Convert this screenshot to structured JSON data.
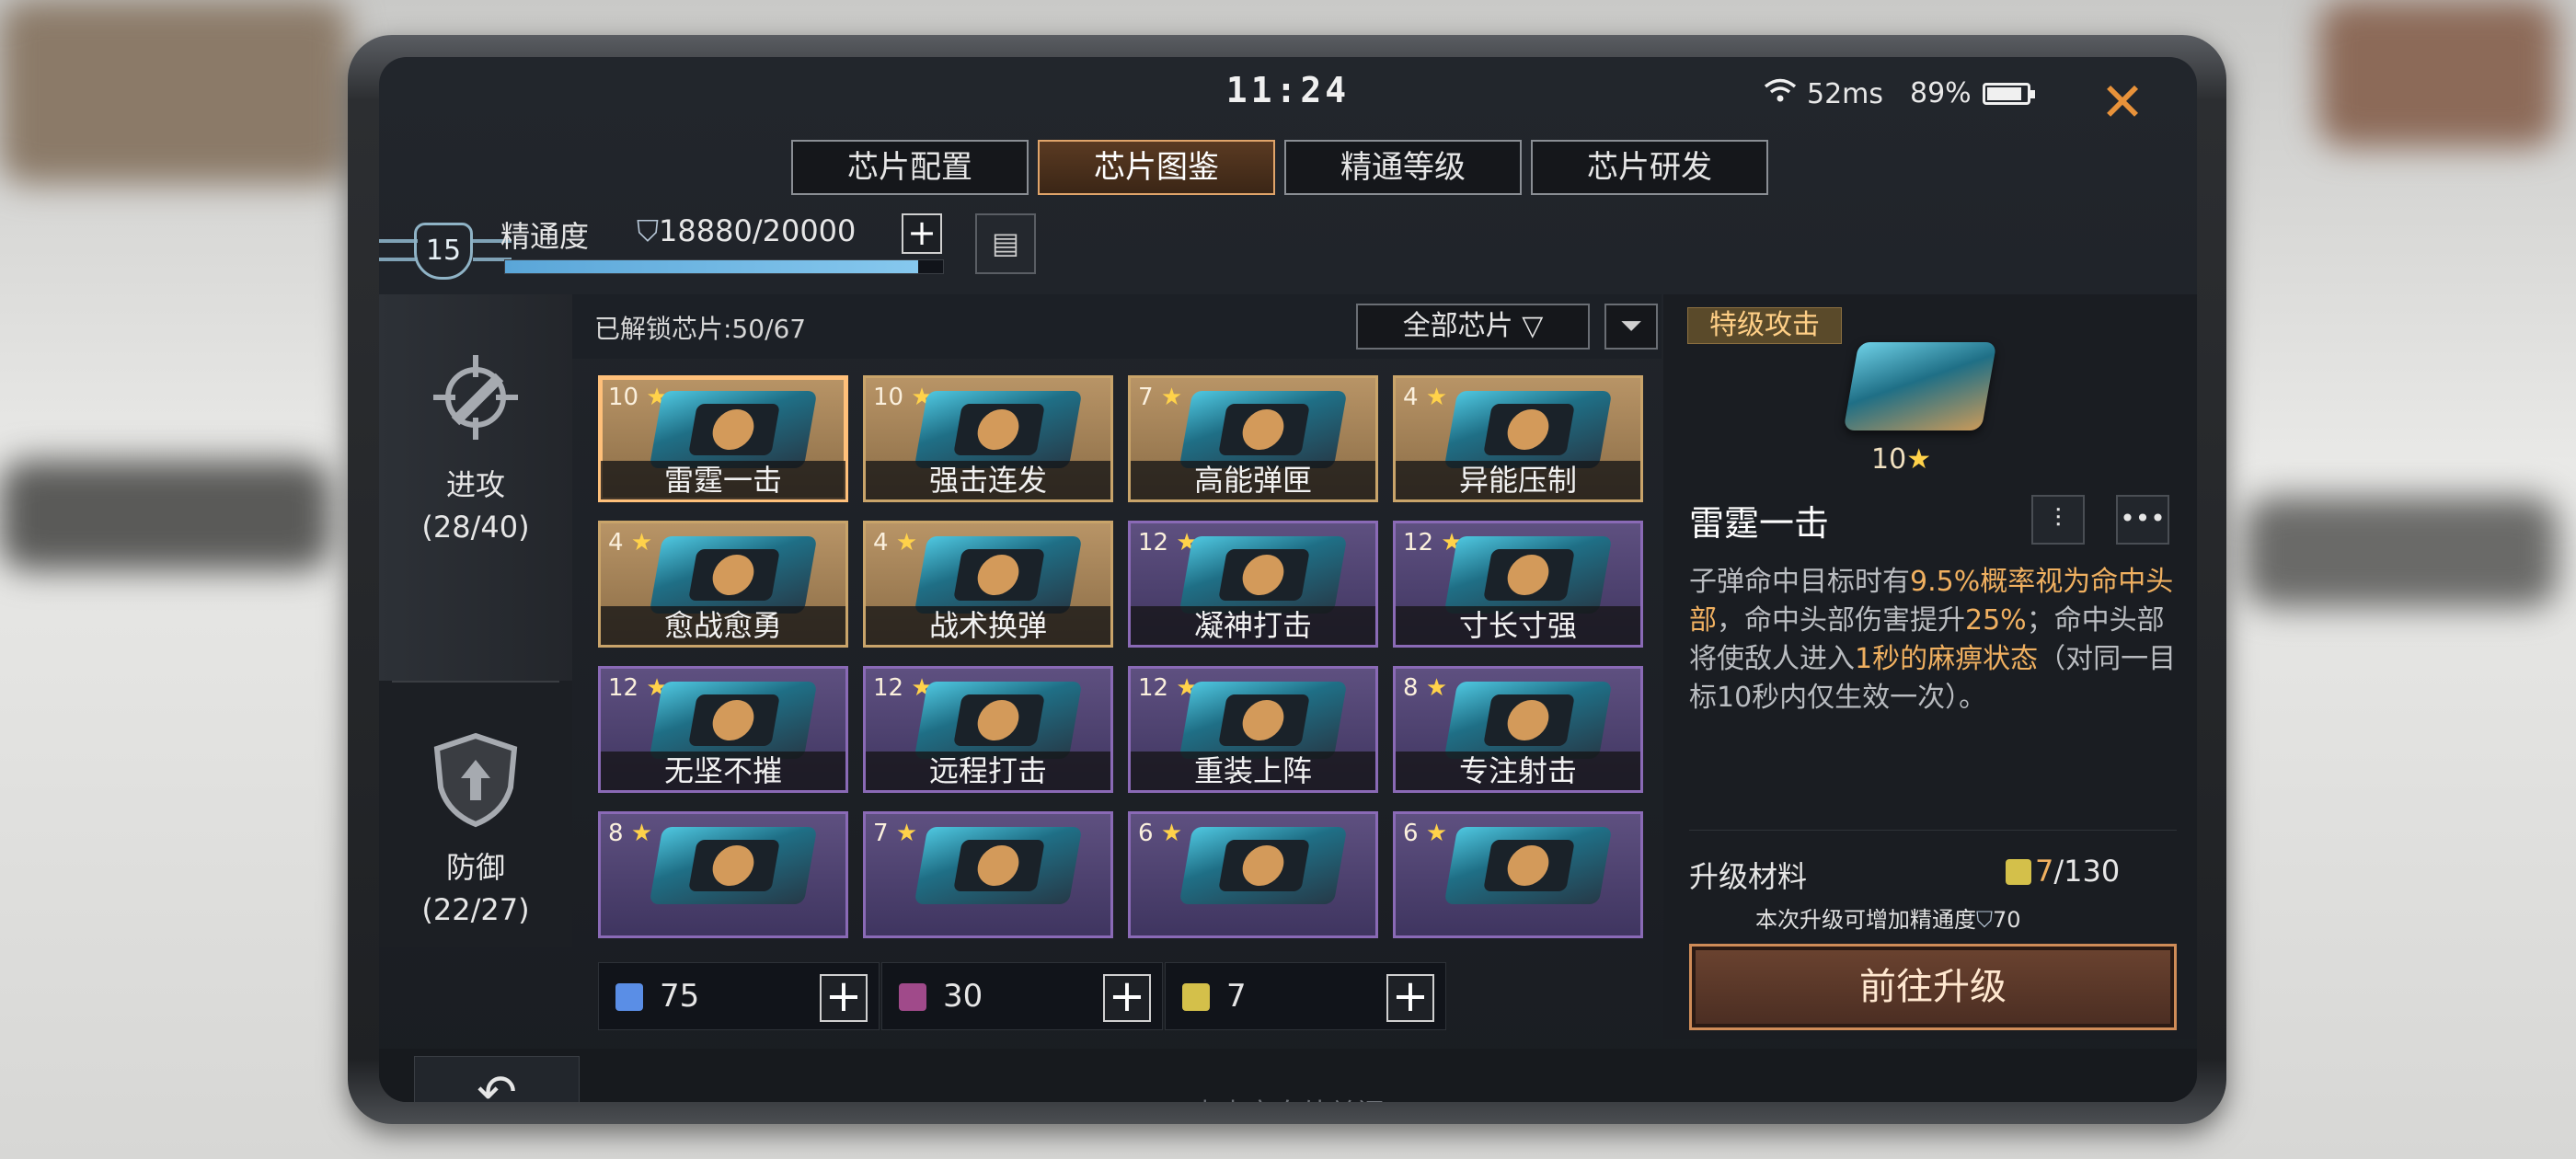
{
  "status": {
    "time": "11:24",
    "ping": "52ms",
    "battery": "89%",
    "battery_level": 0.89
  },
  "tabs": [
    {
      "label": "芯片配置",
      "active": false
    },
    {
      "label": "芯片图鉴",
      "active": true
    },
    {
      "label": "精通等级",
      "active": false
    },
    {
      "label": "芯片研发",
      "active": false
    }
  ],
  "mastery": {
    "level": "15",
    "label": "精通度",
    "value": "18880/20000",
    "progress": 0.944
  },
  "sidebar": [
    {
      "label": "进攻",
      "count": "(28/40)",
      "icon": "crosshair-icon",
      "active": true
    },
    {
      "label": "防御",
      "count": "(22/27)",
      "icon": "shield-icon",
      "active": false
    }
  ],
  "grid": {
    "unlocked": "已解锁芯片:50/67",
    "filter": "全部芯片",
    "chips": [
      {
        "level": "10",
        "name": "雷霆一击",
        "rarity": "gold",
        "selected": true
      },
      {
        "level": "10",
        "name": "强击连发",
        "rarity": "gold"
      },
      {
        "level": "7",
        "name": "高能弹匣",
        "rarity": "gold"
      },
      {
        "level": "4",
        "name": "异能压制",
        "rarity": "gold"
      },
      {
        "level": "4",
        "name": "愈战愈勇",
        "rarity": "gold"
      },
      {
        "level": "4",
        "name": "战术换弹",
        "rarity": "gold"
      },
      {
        "level": "12",
        "name": "凝神打击",
        "rarity": "purple"
      },
      {
        "level": "12",
        "name": "寸长寸强",
        "rarity": "purple"
      },
      {
        "level": "12",
        "name": "无坚不摧",
        "rarity": "purple"
      },
      {
        "level": "12",
        "name": "远程打击",
        "rarity": "purple"
      },
      {
        "level": "12",
        "name": "重装上阵",
        "rarity": "purple"
      },
      {
        "level": "8",
        "name": "专注射击",
        "rarity": "purple"
      },
      {
        "level": "8",
        "name": "",
        "rarity": "purple"
      },
      {
        "level": "7",
        "name": "",
        "rarity": "purple"
      },
      {
        "level": "6",
        "name": "",
        "rarity": "purple"
      },
      {
        "level": "6",
        "name": "",
        "rarity": "purple"
      }
    ]
  },
  "resources": [
    {
      "value": "75",
      "color": "#5a8ee6"
    },
    {
      "value": "30",
      "color": "#a04a8a"
    },
    {
      "value": "7",
      "color": "#d4c04a"
    }
  ],
  "detail": {
    "category": "特级攻击",
    "level": "10",
    "name": "雷霆一击",
    "desc_parts": [
      {
        "t": "子弹命中目标时有",
        "hl": false
      },
      {
        "t": "9.5%概率视为命中头部",
        "hl": true
      },
      {
        "t": "，命中头部伤害提升",
        "hl": false
      },
      {
        "t": "25%",
        "hl": true
      },
      {
        "t": "；命中头部将使敌人进入",
        "hl": false
      },
      {
        "t": "1秒的麻痹状态",
        "hl": true
      },
      {
        "t": "（对同一目标10秒内仅生效一次）。",
        "hl": false
      }
    ],
    "material_label": "升级材料",
    "material_have": "7",
    "material_need": "/130",
    "upgrade_hint": "本次升级可增加精通度",
    "upgrade_gain": "70",
    "upgrade_button": "前往升级"
  },
  "bottom": {
    "close_hint": "点击空白处关闭"
  },
  "colors": {
    "accent_orange": "#e8923a",
    "highlight": "#f0b060",
    "gold_card": "#b89466",
    "purple_card": "#5e5080"
  }
}
